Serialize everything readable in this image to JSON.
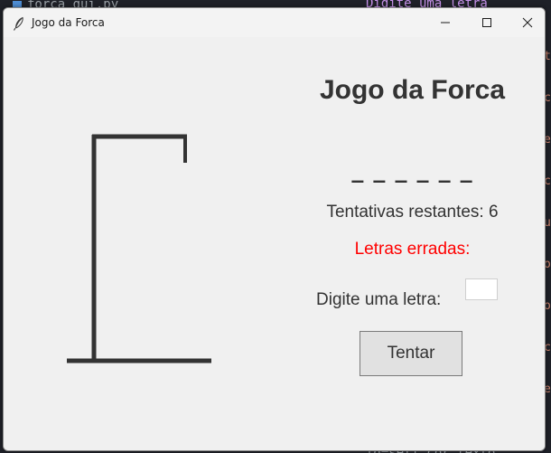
{
  "background": {
    "tab_label": "forca_gui.py",
    "code_top": "Digite uma letra",
    "code_bottom": "fg=self.cor_texto"
  },
  "window": {
    "title": "Jogo da Forca",
    "controls": [
      "minimize",
      "maximize",
      "close"
    ]
  },
  "game": {
    "title": "Jogo da Forca",
    "word_display": "_ _ _ _ _ _",
    "attempts_text": "Tentativas restantes: 6",
    "wrong_letters_text": "Letras erradas:",
    "input_label": "Digite uma letra:",
    "input_value": "",
    "try_button_label": "Tentar"
  },
  "colors": {
    "window_bg": "#f0f0f0",
    "text": "#333333",
    "wrong_letters": "#ff0000",
    "gallows": "#333333",
    "button_bg": "#e1e1e1"
  }
}
